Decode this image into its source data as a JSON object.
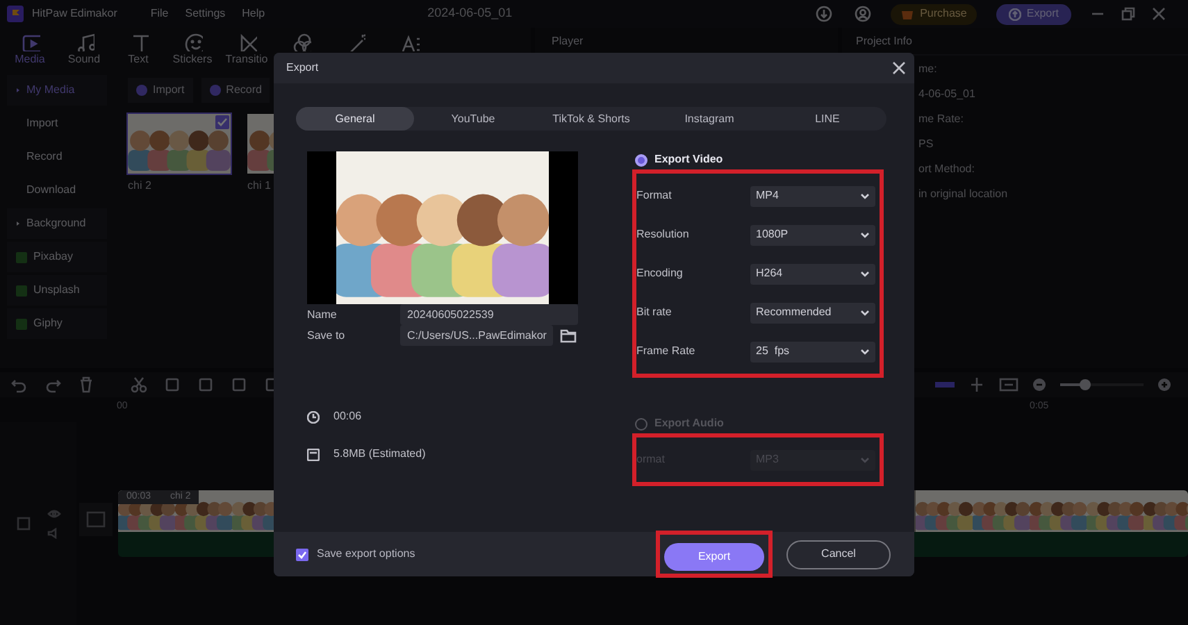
{
  "app": {
    "name": "HitPaw Edimakor",
    "menu": [
      "File",
      "Settings",
      "Help"
    ],
    "project_title": "2024-06-05_01",
    "purchase": "Purchase",
    "export": "Export"
  },
  "toolbar": [
    {
      "label": "Media",
      "selected": true
    },
    {
      "label": "Sound",
      "selected": false
    },
    {
      "label": "Text",
      "selected": false
    },
    {
      "label": "Stickers",
      "selected": false
    },
    {
      "label": "Transitio",
      "selected": false
    },
    {
      "selected": false
    },
    {
      "selected": false
    },
    {
      "selected": false
    }
  ],
  "player": {
    "title": "Player"
  },
  "sidebar": [
    {
      "label": "My Media",
      "selected": true,
      "kind": "group"
    },
    {
      "label": "Import",
      "selected": false,
      "kind": "item"
    },
    {
      "label": "Record",
      "selected": false,
      "kind": "item"
    },
    {
      "label": "Download",
      "selected": false,
      "kind": "item"
    },
    {
      "label": "Background",
      "selected": false,
      "kind": "group"
    },
    {
      "label": "Pixabay",
      "selected": false,
      "kind": "source"
    },
    {
      "label": "Unsplash",
      "selected": false,
      "kind": "source"
    },
    {
      "label": "Giphy",
      "selected": false,
      "kind": "source"
    }
  ],
  "media_buttons": [
    "Import",
    "Record"
  ],
  "media": [
    {
      "name": "chi 2",
      "checked": true
    },
    {
      "name": "chi 1",
      "checked": false
    }
  ],
  "project_info": {
    "title": "Project Info",
    "lines": [
      "me:",
      "4-06-05_01",
      "me Rate:",
      "PS",
      "ort Method:",
      "in original location"
    ]
  },
  "timeline": {
    "ruler": [
      "00",
      "0:05"
    ],
    "zoom": {
      "level": 0.3
    },
    "clip": {
      "time": "00:03",
      "name": "chi 2"
    }
  },
  "dialog": {
    "title": "Export",
    "tabs": [
      {
        "label": "General",
        "selected": true
      },
      {
        "label": "YouTube",
        "selected": false
      },
      {
        "label": "TikTok & Shorts",
        "selected": false
      },
      {
        "label": "Instagram",
        "selected": false
      },
      {
        "label": "LINE",
        "selected": false
      }
    ],
    "name": {
      "label": "Name",
      "value": "20240605022539"
    },
    "save_to": {
      "label": "Save to",
      "value": "C:/Users/US...PawEdimakor"
    },
    "duration": "00:06",
    "size": "5.8MB (Estimated)",
    "export_video": {
      "label": "Export Video",
      "selected": true,
      "settings": [
        {
          "label": "Format",
          "value": "MP4"
        },
        {
          "label": "Resolution",
          "value": "1080P"
        },
        {
          "label": "Encoding",
          "value": "H264"
        },
        {
          "label": "Bit rate",
          "value": "Recommended"
        },
        {
          "label": "Frame Rate",
          "value": "25  fps"
        }
      ]
    },
    "export_audio": {
      "label": "Export Audio",
      "selected": false,
      "disabled": true,
      "settings": [
        {
          "label": "ormat",
          "value": "MP3"
        }
      ]
    },
    "save_options": {
      "label": "Save export options",
      "checked": true
    },
    "buttons": [
      {
        "label": "Export",
        "kind": "primary"
      },
      {
        "label": "Cancel",
        "kind": "secondary"
      }
    ]
  }
}
